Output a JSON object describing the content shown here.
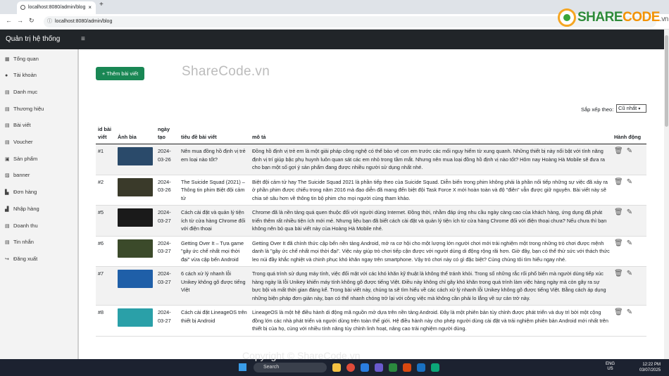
{
  "browser": {
    "tab_title": "localhost:8080/admin/blog",
    "url": "localhost:8080/admin/blog"
  },
  "header": {
    "brand": "Quản trị hệ thống"
  },
  "sidebar": {
    "items": [
      {
        "label": "Tổng quan",
        "icon": "dashboard-icon"
      },
      {
        "label": "Tài khoản",
        "icon": "user-icon"
      },
      {
        "label": "Danh mục",
        "icon": "table-icon"
      },
      {
        "label": "Thương hiệu",
        "icon": "table-icon"
      },
      {
        "label": "Bài viết",
        "icon": "table-icon"
      },
      {
        "label": "Voucher",
        "icon": "table-icon"
      },
      {
        "label": "Sản phẩm",
        "icon": "box-icon"
      },
      {
        "label": "banner",
        "icon": "image-icon"
      },
      {
        "label": "Đơn hàng",
        "icon": "cart-icon"
      },
      {
        "label": "Nhập hàng",
        "icon": "truck-icon"
      },
      {
        "label": "Doanh thu",
        "icon": "table-icon"
      },
      {
        "label": "Tin nhắn",
        "icon": "table-icon"
      },
      {
        "label": "Đăng xuất",
        "icon": "logout-icon"
      }
    ]
  },
  "main": {
    "add_button": "+ Thêm bài viết",
    "sort_label": "Sắp xếp theo:",
    "sort_value": "Cũ nhất",
    "columns": [
      "id bài viết",
      "Ảnh bìa",
      "ngày tạo",
      "tiêu đề bài viết",
      "mô tả",
      "Hành động"
    ],
    "rows": [
      {
        "id": "#1",
        "date": "2024-03-26",
        "title": "Nên mua đồng hồ định vị trẻ em loại nào tốt?",
        "desc": "Đồng hồ định vị trẻ em là một giải pháp công nghệ có thể bảo vệ con em trước các mối nguy hiểm từ xung quanh. Những thiết bị này nổi bật với tính năng định vị trí giúp bậc phụ huynh luôn quan sát các em nhỏ trong tầm mắt. Nhưng nên mua loại đồng hồ định vị nào tốt? Hôm nay Hoàng Hà Mobile sẽ đưa ra cho bạn một số gợi ý sản phẩm đang được nhiều người sử dụng nhất nhé.",
        "thumb": "#2a4a6a"
      },
      {
        "id": "#2",
        "date": "2024-03-26",
        "title": "The Suicide Squad (2021) – Thông tin phim Biệt đội cảm tử",
        "desc": "Biệt đội cảm tử hay The Suicide Squad 2021 là phần tiếp theo của Suicide Squad. Diễn biến trong phim không phải là phần nối tiếp những sự việc đã xảy ra ở phần phim được chiếu trong năm 2016 mà đạo diễn đã mang đến biệt đội Task Force X mới hoàn toàn và độ \"điên\" vẫn được giữ nguyên. Bài viết này sẽ chia sẻ sâu hơn về thông tin bộ phim cho mọi người cùng tham khảo.",
        "thumb": "#3a3a2a"
      },
      {
        "id": "#5",
        "date": "2024-03-27",
        "title": "Cách cài đặt và quản lý tiện ích từ cửa hàng Chrome đối với điện thoại",
        "desc": "Chrome đã là nền tảng quá quen thuộc đối với người dùng Internet. Đồng thời, nhằm đáp ứng nhu cầu ngày càng cao của khách hàng, ứng dụng đã phát triển thêm rất nhiều tiện ích mới mẻ. Nhưng liệu bạn đã biết cách cài đặt và quản lý tiện ích từ cửa hàng Chrome đối với điện thoại chưa? Nếu chưa thì bạn không nên bỏ qua bài viết này của Hoàng Hà Mobile nhé.",
        "thumb": "#1a1a1a"
      },
      {
        "id": "#6",
        "date": "2024-03-27",
        "title": "Getting Over It – Tựa game \"gây ức chế nhất mọi thời đại\" vừa cập bến Android",
        "desc": "Getting Over It đã chính thức cập bến nền tảng Android, mở ra cơ hội cho một lượng lớn người chơi mới trải nghiệm một trong những trò chơi được mệnh danh là \"gây ức chế nhất mọi thời đại\". Việc này giúp trò chơi tiếp cận được với người dùng di động rộng rãi hơn. Giờ đây, bạn có thể thử sức với thách thức leo núi đầy khắc nghiệt và chinh phục khó khăn ngay trên smartphone. Vậy trò chơi này có gì đặc biệt? Cùng chúng tôi tìm hiểu ngay nhé.",
        "thumb": "#3b4a2a"
      },
      {
        "id": "#7",
        "date": "2024-03-27",
        "title": "6 cách xử lý nhanh lỗi Unikey không gõ được tiếng Việt",
        "desc": "Trong quá trình sử dụng máy tính, việc đối mặt với các khó khăn kỹ thuật là không thể tránh khỏi. Trong số những rắc rối phổ biến mà người dùng tiếp xúc hàng ngày là lỗi Unikey khiến máy tính không gõ được tiếng Việt. Điều này không chỉ gây khó khăn trong quá trình làm việc hàng ngày mà còn gây ra sự bực bội và mất thời gian đáng kể. Trong bài viết này, chúng ta sẽ tìm hiểu về các cách xử lý nhanh lỗi Unikey không gõ được tiếng Việt. Bằng cách áp dụng những biện pháp đơn giản này, bạn có thể nhanh chóng trở lại với công việc mà không cần phải lo lắng về sự cản trở này.",
        "thumb": "#1f5fa8"
      },
      {
        "id": "#8",
        "date": "2024-03-27",
        "title": "Cách cài đặt LineageOS trên thiết bị Android",
        "desc": "LineageOS là một hệ điều hành di động mã nguồn mở dựa trên nền tảng Android. Đây là một phiên bản tùy chỉnh được phát triển và duy trì bởi một cộng đồng lớn các nhà phát triển và người dùng trên toàn thế giới. Hệ điều hành này cho phép người dùng cài đặt và trải nghiệm phiên bản Android mới nhất trên thiết bị của họ, cùng với nhiều tính năng tùy chỉnh linh hoạt, nâng cao trải nghiệm người dùng.",
        "thumb": "#2aa0a8"
      }
    ]
  },
  "watermarks": {
    "center": "ShareCode.vn",
    "logo_share": "SHARE",
    "logo_code": "CODE",
    "logo_vn": ".vn",
    "bottom": "Copyright © ShareCode.vn"
  },
  "taskbar": {
    "search": "Search",
    "lang": "ENG",
    "region": "US",
    "time": "12:22 PM",
    "date": "03/07/2025"
  },
  "colors": {
    "accent": "#198754",
    "header": "#212529"
  }
}
